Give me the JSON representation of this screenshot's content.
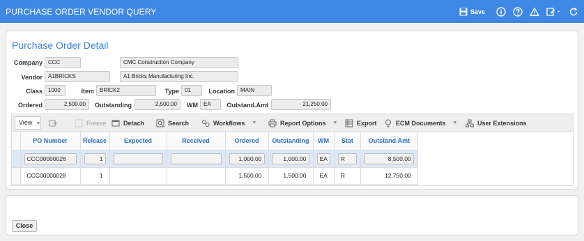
{
  "app": {
    "title": "PURCHASE ORDER VENDOR QUERY",
    "save_label": "Save"
  },
  "panel": {
    "title": "Purchase Order Detail"
  },
  "form": {
    "company_label": "Company",
    "company_code": "CCC",
    "company_name": "CMC Construction Company",
    "vendor_label": "Vendor",
    "vendor_code": "A1BRICKS",
    "vendor_name": "A1 Bricks Manufacturing Inc.",
    "class_label": "Class",
    "class_value": "1000",
    "item_label": "Item",
    "item_value": "BRICK2",
    "type_label": "Type",
    "type_value": "01",
    "location_label": "Location",
    "location_value": "MAIN",
    "ordered_label": "Ordered",
    "ordered_value": "2,500.00",
    "outstanding_label": "Outstanding",
    "outstanding_value": "2,500.00",
    "wm_label": "WM",
    "wm_value": "EA",
    "outstand_amt_label": "Outstand.Amt",
    "outstand_amt_value": "21,250.00"
  },
  "toolbar": {
    "view": "View",
    "freeze": "Freeze",
    "detach": "Detach",
    "search": "Search",
    "workflows": "Workflows",
    "report_options": "Report Options",
    "export": "Export",
    "ecm_documents": "ECM Documents",
    "user_extensions": "User Extensions"
  },
  "grid": {
    "columns": [
      "PO Number",
      "Release",
      "Expected",
      "Received",
      "Ordered",
      "Outstanding",
      "WM",
      "Stat",
      "Outstand.Amt"
    ],
    "rows": [
      {
        "po_number": "CCC00000026",
        "release": "1",
        "expected": "",
        "received": "",
        "ordered": "1,000.00",
        "outstanding": "1,000.00",
        "wm": "EA",
        "stat": "R",
        "outstand_amt": "8,500.00"
      },
      {
        "po_number": "CCC00000028",
        "release": "1",
        "expected": "",
        "received": "",
        "ordered": "1,500.00",
        "outstanding": "1,500.00",
        "wm": "EA",
        "stat": "R",
        "outstand_amt": "12,750.00"
      }
    ]
  },
  "footer": {
    "close": "Close"
  },
  "colors": {
    "titlebar": "#3f87e4",
    "accent": "#3a7fd8",
    "header_text": "#2f6fbf",
    "selected_row": "#dde8f7"
  }
}
